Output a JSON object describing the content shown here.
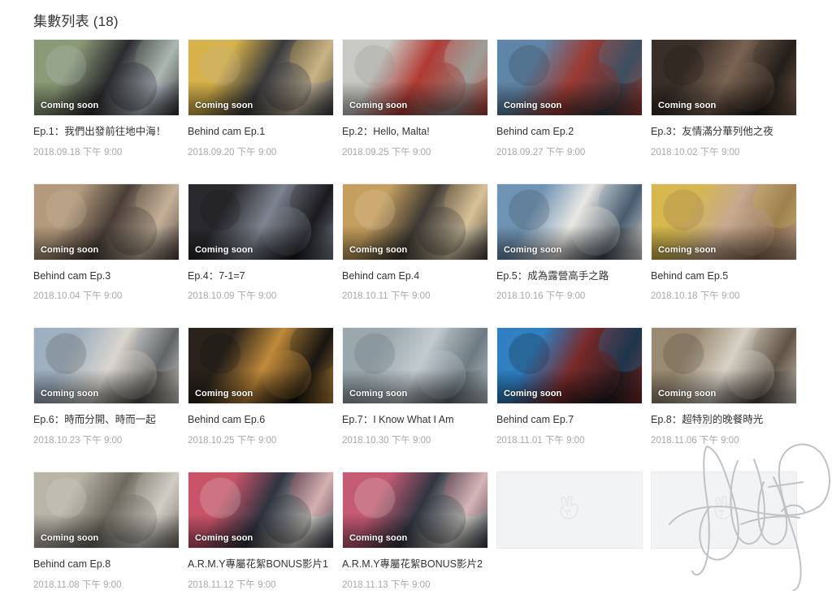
{
  "header": {
    "title": "集數列表 (18)",
    "count": 18
  },
  "labels": {
    "coming_soon": "Coming soon",
    "placeholder_icon": "vlive-peace-hand-icon",
    "signature_overlay": "handwritten-signature-scribble"
  },
  "colors": {
    "page_background": "#ffffff",
    "title_text": "#333333",
    "card_title_text": "#333333",
    "card_date_text": "#a8a8a8",
    "badge_text": "#ffffff",
    "placeholder_background": "#f2f3f5",
    "placeholder_icon": "#dfe4e8",
    "signature_stroke": "#bfc3c6"
  },
  "episodes": [
    {
      "title": "Ep.1：我們出發前往地中海！",
      "date": "2018.09.18 下午 9:00",
      "badge": "Coming soon",
      "thumb": "two-men-bucket-hats-outdoors",
      "c1": "#8a9a76",
      "c2": "#2b2b2f",
      "c3": "#b9c2c9"
    },
    {
      "title": "Behind cam Ep.1",
      "date": "2018.09.20 下午 9:00",
      "badge": "Coming soon",
      "thumb": "men-by-yellow-container-wall",
      "c1": "#d7b24a",
      "c2": "#3a3a3c",
      "c3": "#c3b49a"
    },
    {
      "title": "Ep.2：Hello, Malta!",
      "date": "2018.09.25 下午 9:00",
      "badge": "Coming soon",
      "thumb": "man-red-shirt-with-camera",
      "c1": "#c8c9c4",
      "c2": "#b23a34",
      "c3": "#8d8f8a"
    },
    {
      "title": "Behind cam Ep.2",
      "date": "2018.09.27 下午 9:00",
      "badge": "Coming soon",
      "thumb": "group-on-boat-by-sea",
      "c1": "#5f86a8",
      "c2": "#9c3b33",
      "c3": "#2f3b46"
    },
    {
      "title": "Ep.3：友情滿分華列他之夜",
      "date": "2018.10.02 下午 9:00",
      "badge": "Coming soon",
      "thumb": "night-cafe-table-scene",
      "c1": "#3a2f28",
      "c2": "#7a6352",
      "c3": "#1d1814"
    },
    {
      "title": "Behind cam Ep.3",
      "date": "2018.10.04 下午 9:00",
      "badge": "Coming soon",
      "thumb": "group-sitting-on-bench",
      "c1": "#b39a7c",
      "c2": "#4a3f38",
      "c3": "#cbb9a4"
    },
    {
      "title": "Ep.4：7-1=7",
      "date": "2018.10.09 下午 9:00",
      "badge": "Coming soon",
      "thumb": "man-in-black-with-sunglasses",
      "c1": "#2a2a2e",
      "c2": "#7d8490",
      "c3": "#161619"
    },
    {
      "title": "Behind cam Ep.4",
      "date": "2018.10.11 下午 9:00",
      "badge": "Coming soon",
      "thumb": "group-with-straw-hats-seaside",
      "c1": "#c59f5e",
      "c2": "#3f3a34",
      "c3": "#e0cfae"
    },
    {
      "title": "Ep.5：成為露營高手之路",
      "date": "2018.10.16 下午 9:00",
      "badge": "Coming soon",
      "thumb": "man-striped-shirt-hat-by-water",
      "c1": "#6f93b4",
      "c2": "#e9e8e4",
      "c3": "#3b4754"
    },
    {
      "title": "Behind cam Ep.5",
      "date": "2018.10.18 下午 9:00",
      "badge": "Coming soon",
      "thumb": "person-lying-on-bed-yellow",
      "c1": "#d6b84e",
      "c2": "#c7a98f",
      "c3": "#8a6c4e"
    },
    {
      "title": "Ep.6：時而分開、時而一起",
      "date": "2018.10.23 下午 9:00",
      "badge": "Coming soon",
      "thumb": "two-men-outdoor-daytime-talk",
      "c1": "#9fb0c0",
      "c2": "#d9d6cf",
      "c3": "#4c4a46"
    },
    {
      "title": "Behind cam Ep.6",
      "date": "2018.10.25 下午 9:00",
      "badge": "Coming soon",
      "thumb": "night-street-lights-scene",
      "c1": "#2a231c",
      "c2": "#c08a3a",
      "c3": "#12100d"
    },
    {
      "title": "Ep.7：I Know What I Am",
      "date": "2018.10.30 下午 9:00",
      "badge": "Coming soon",
      "thumb": "person-swimming-in-open-water",
      "c1": "#9aa7ad",
      "c2": "#c2cbd0",
      "c3": "#5d6a72"
    },
    {
      "title": "Behind cam Ep.7",
      "date": "2018.11.01 下午 9:00",
      "badge": "Coming soon",
      "thumb": "blue-towel-closeup",
      "c1": "#2f7fc1",
      "c2": "#7a2a2a",
      "c3": "#161a20"
    },
    {
      "title": "Ep.8：超特別的晚餐時光",
      "date": "2018.11.06 下午 9:00",
      "badge": "Coming soon",
      "thumb": "indoor-room-gathering",
      "c1": "#9a8a72",
      "c2": "#d8d2c6",
      "c3": "#4a4036"
    },
    {
      "title": "Behind cam Ep.8",
      "date": "2018.11.08 下午 9:00",
      "badge": "Coming soon",
      "thumb": "group-with-luggage-by-van",
      "c1": "#b9b4a8",
      "c2": "#6f6a60",
      "c3": "#d9d6cf"
    },
    {
      "title": "A.R.M.Y專屬花絮BONUS影片1",
      "date": "2018.11.12 下午 9:00",
      "badge": "Coming soon",
      "thumb": "group-photo-colorful-outfits",
      "c1": "#c9546a",
      "c2": "#2e3440",
      "c3": "#d8d4cc"
    },
    {
      "title": "A.R.M.Y專屬花絮BONUS影片2",
      "date": "2018.11.13 下午 9:00",
      "badge": "Coming soon",
      "thumb": "group-photo-colorful-outfits-2",
      "c1": "#c45a74",
      "c2": "#303641",
      "c3": "#dcd8d0"
    }
  ],
  "placeholders": [
    {
      "icon": "vlive-peace-hand-icon",
      "has_signature": false
    },
    {
      "icon": "vlive-peace-hand-icon",
      "has_signature": true
    }
  ]
}
